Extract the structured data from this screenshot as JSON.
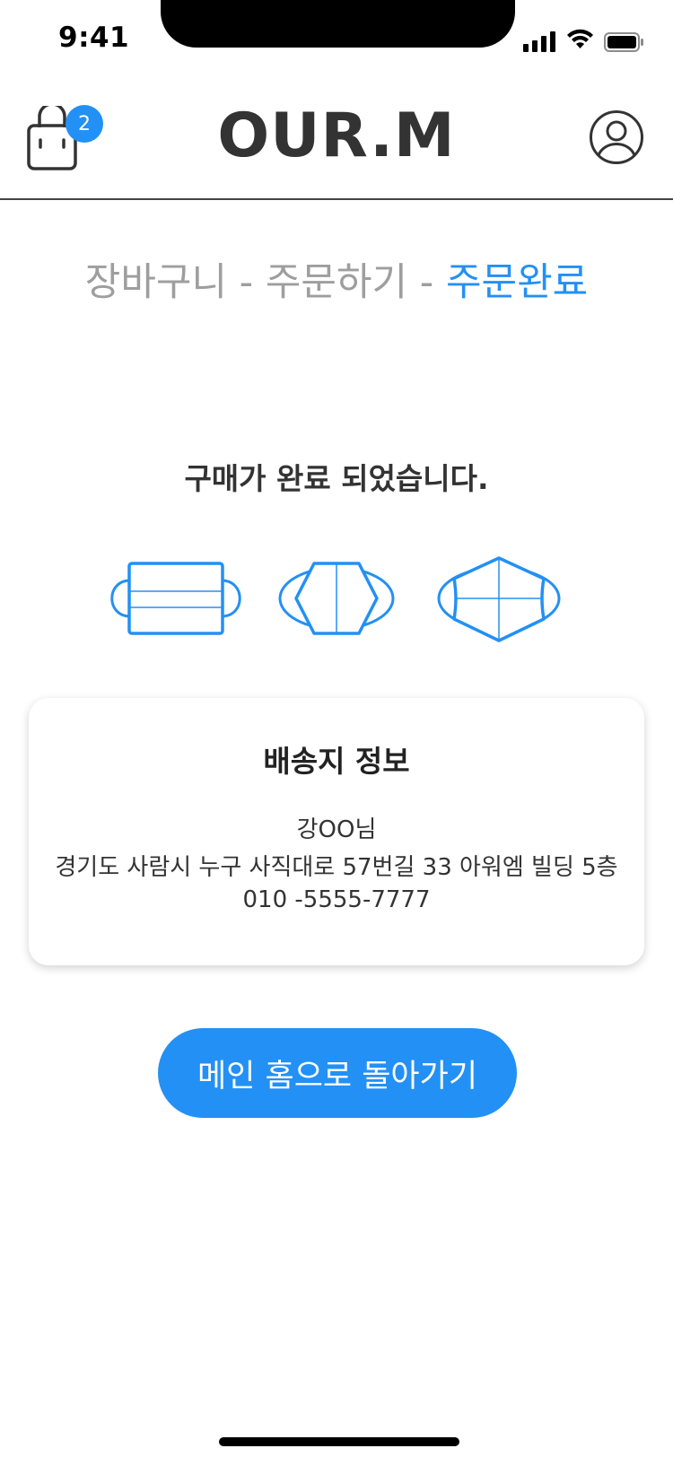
{
  "status_bar": {
    "time": "9:41"
  },
  "header": {
    "logo": "OUR.M",
    "cart_badge_count": "2",
    "cart_icon": "shopping-bag-icon",
    "profile_icon": "user-circle-icon"
  },
  "steps": {
    "cart": "장바구니",
    "separator1": " - ",
    "order": "주문하기",
    "separator2": " - ",
    "complete": "주문완료"
  },
  "main": {
    "title": "구매가 완료 되었습니다.",
    "mask_icons": [
      "flat-mask-icon",
      "fold-mask-icon",
      "kf94-mask-icon"
    ]
  },
  "shipping": {
    "title": "배송지 정보",
    "name": "강OO님",
    "address": "경기도 사람시 누구 사직대로 57번길 33 아워엠 빌딩 5층",
    "phone": "010 -5555-7777"
  },
  "actions": {
    "home_label": "메인 홈으로 돌아가기"
  },
  "colors": {
    "accent": "#2390f5",
    "text": "#333333",
    "inactive": "#9e9e9e"
  }
}
